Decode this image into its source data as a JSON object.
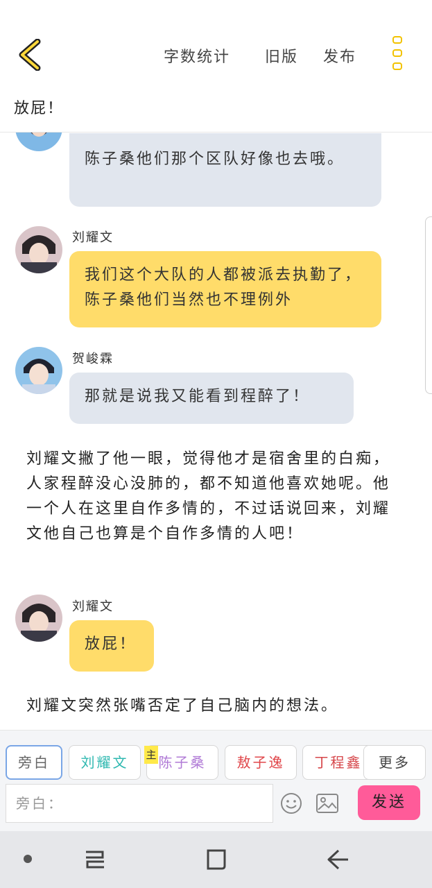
{
  "header": {
    "actions": [
      "字数统计",
      "旧版",
      "发布"
    ],
    "draft_title": "放屁！"
  },
  "chat": {
    "bubble1": "陈子桑他们那个区队好像也去哦。",
    "msg2": {
      "speaker": "刘耀文",
      "text": "我们这个大队的人都被派去执勤了，陈子桑他们当然也不理例外"
    },
    "msg3": {
      "speaker": "贺峻霖",
      "text": "那就是说我又能看到程醉了！"
    },
    "narration1": "刘耀文撇了他一眼，觉得他才是宿舍里的白痴，人家程醉没心没肺的，都不知道他喜欢她呢。他一个人在这里自作多情的，不过话说回来，刘耀文他自己也算是个自作多情的人吧！",
    "msg4": {
      "speaker": "刘耀文",
      "text": "放屁！"
    },
    "narration2": "刘耀文突然张嘴否定了自己脑内的想法。"
  },
  "roles": [
    {
      "label": "旁白",
      "color": "#666666"
    },
    {
      "label": "刘耀文",
      "color": "#2fb8b0"
    },
    {
      "label": "陈子桑",
      "color": "#b07ad6",
      "tag": "主"
    },
    {
      "label": "敖子逸",
      "color": "#e0464a"
    },
    {
      "label": "丁程鑫",
      "color": "#d6464a"
    },
    {
      "label": "更多",
      "color": "#444444"
    }
  ],
  "composer": {
    "placeholder": "旁白：",
    "send_label": "发送"
  }
}
